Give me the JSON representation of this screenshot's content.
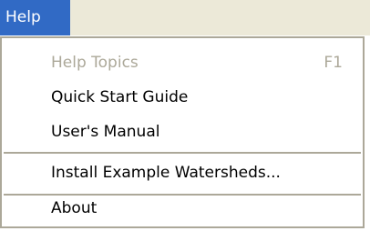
{
  "menubar": {
    "title": "Help"
  },
  "menu": {
    "items": [
      {
        "label": "Help Topics",
        "shortcut": "F1",
        "disabled": true
      },
      {
        "label": "Quick Start Guide"
      },
      {
        "label": "User's Manual"
      },
      {
        "label": "Install Example Watersheds..."
      },
      {
        "label": "About"
      }
    ]
  },
  "colors": {
    "menubar_bg": "#ece9d8",
    "highlight": "#316ac5",
    "disabled_text": "#aca899",
    "border": "#aca899"
  }
}
